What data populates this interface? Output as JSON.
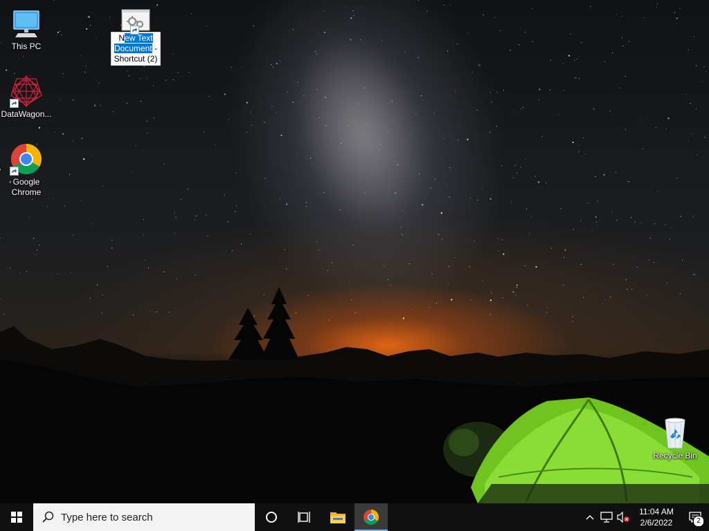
{
  "desktop": {
    "icons": [
      {
        "label": "This PC"
      },
      {
        "label": "DataWagon..."
      },
      {
        "label": "Google Chrome"
      },
      {
        "label": "Recycle Bin"
      }
    ],
    "selected_icon": {
      "label_parts": [
        "N",
        "ew Text",
        "Document",
        " -",
        "Shortcut (2)"
      ]
    }
  },
  "taskbar": {
    "search_placeholder": "Type here to search",
    "clock": {
      "time": "11:04 AM",
      "date": "2/6/2022"
    },
    "notification_count": "2",
    "pinned": [
      {
        "icon": "cortana-circle-icon"
      },
      {
        "icon": "task-view-icon"
      },
      {
        "icon": "file-explorer-icon"
      },
      {
        "icon": "chrome-icon",
        "active": true
      }
    ]
  },
  "colors": {
    "taskbar": "#101010",
    "selection": "#0078d7",
    "tent": "#7ed321",
    "horizon_glow": "#e86814"
  }
}
